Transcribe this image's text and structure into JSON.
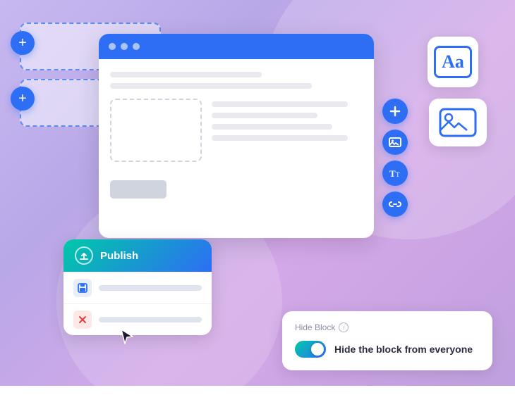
{
  "background": {
    "gradient_start": "#c8b8f0",
    "gradient_end": "#c0a0e0"
  },
  "dashed_cards": {
    "card1": {
      "label": "dashed-block-1"
    },
    "card2": {
      "label": "dashed-block-2"
    }
  },
  "plus_buttons": {
    "btn1_label": "+",
    "btn2_label": "+"
  },
  "browser_window": {
    "title": "Browser Window"
  },
  "sidebar_icons": {
    "add": "+",
    "image": "🖼",
    "text": "Tt",
    "link": "🔗"
  },
  "tool_cards": {
    "aa_label": "Aa",
    "img_label": "Image card"
  },
  "publish_card": {
    "publish_label": "Publish",
    "save_label": "Save",
    "cancel_label": "Cancel"
  },
  "hide_block_card": {
    "title": "Hide Block",
    "toggle_label": "Hide the block from everyone",
    "info_char": "i"
  }
}
